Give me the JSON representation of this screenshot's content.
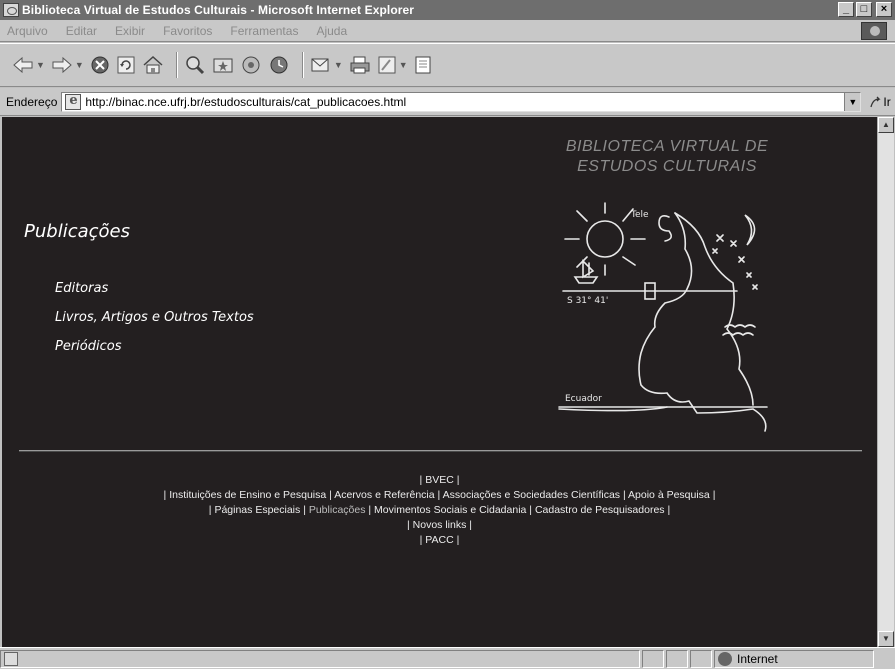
{
  "window": {
    "title": "Biblioteca Virtual de Estudos Culturais - Microsoft Internet Explorer",
    "buttons": {
      "minimize": "_",
      "maximize": "□",
      "close": "×"
    }
  },
  "menubar": [
    {
      "label": "Arquivo"
    },
    {
      "label": "Editar"
    },
    {
      "label": "Exibir"
    },
    {
      "label": "Favoritos"
    },
    {
      "label": "Ferramentas"
    },
    {
      "label": "Ajuda"
    }
  ],
  "toolbar": {
    "icons": [
      "back-arrow-icon",
      "forward-arrow-icon",
      "stop-icon",
      "refresh-icon",
      "home-icon",
      "search-icon",
      "favorites-icon",
      "history-icon",
      "media-icon",
      "mail-icon",
      "print-icon",
      "edit-icon",
      "discuss-icon"
    ]
  },
  "address": {
    "label": "Endereço",
    "url": "http://binac.nce.ufrj.br/estudosculturais/cat_publicacoes.html",
    "go_label": "Ir"
  },
  "page": {
    "site_title_line1": "BIBLIOTECA VIRTUAL DE",
    "site_title_line2": "ESTUDOS CULTURAIS",
    "section_title": "Publicações",
    "links": [
      "Editoras",
      "Livros, Artigos e Outros Textos",
      "Periódicos"
    ],
    "footer": {
      "line1": [
        "BVEC"
      ],
      "line2": [
        "Instituições de Ensino e Pesquisa",
        "Acervos e Referência",
        "Associações e Sociedades Científicas",
        "Apoio à Pesquisa"
      ],
      "line3": [
        "Páginas Especiais",
        "Publicações",
        "Movimentos Sociais e Cidadania",
        "Cadastro de Pesquisadores"
      ],
      "line4": [
        "Novos links"
      ],
      "line5": [
        "PACC"
      ],
      "separator": "|"
    },
    "map_labels": {
      "top": "Tele",
      "ecuador": "Ecuador",
      "coords": "S 31° 41'"
    }
  },
  "statusbar": {
    "zone": "Internet"
  },
  "colors": {
    "page_bg": "#231f20",
    "title_bar": "#6e6e6e",
    "chrome": "#c8c8c8"
  }
}
